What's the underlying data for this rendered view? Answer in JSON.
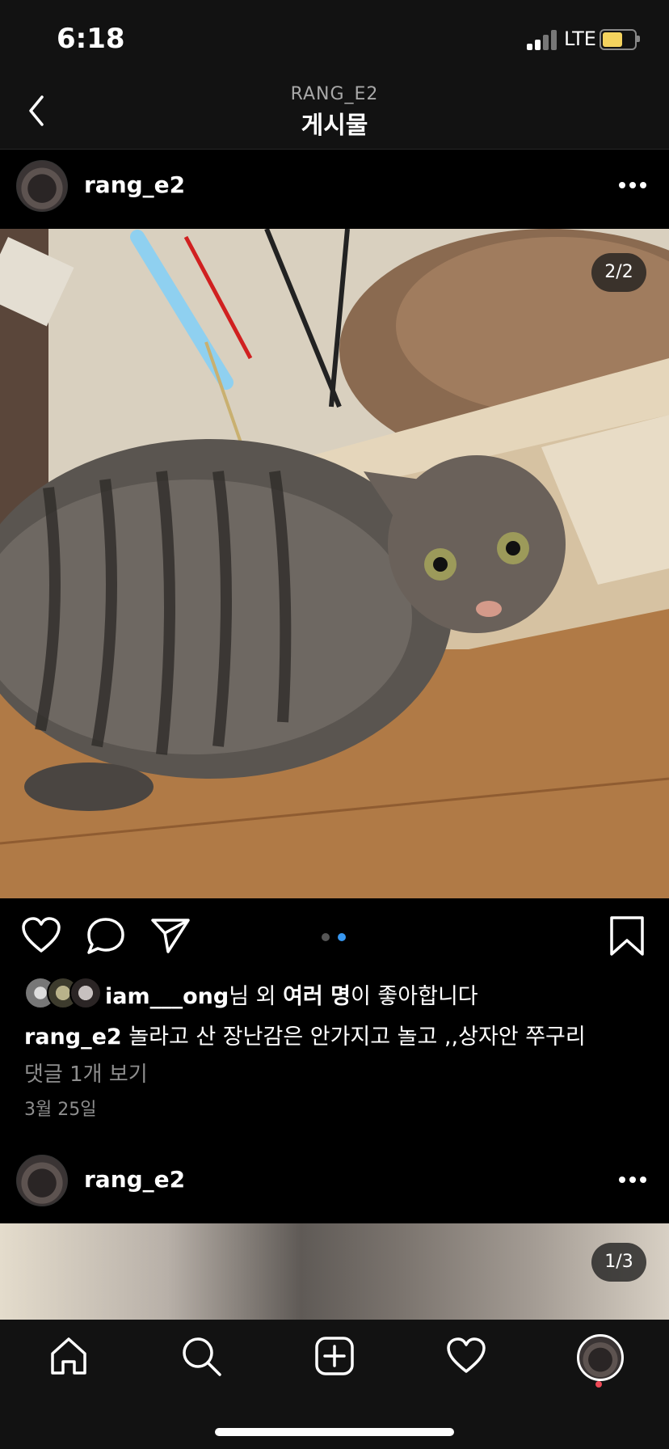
{
  "status_bar": {
    "time": "6:18",
    "carrier": "LTE"
  },
  "nav": {
    "subtitle": "RANG_E2",
    "title": "게시물"
  },
  "post": {
    "username": "rang_e2",
    "image_counter": "2/2",
    "likes": {
      "user": "iam___ong",
      "suffix1": "님 외 ",
      "many": "여러 명",
      "suffix2": "이 좋아합니다"
    },
    "caption": {
      "user": "rang_e2",
      "text": " 놀라고 산 장난감은 안가지고 놀고 ,,상자안 쭈구리"
    },
    "view_comments": "댓글 1개 보기",
    "date": "3월 25일"
  },
  "next_post": {
    "username": "rang_e2",
    "image_counter": "1/3"
  },
  "colors": {
    "background": "#000000",
    "bar": "#121212",
    "active_dot": "#3897f0",
    "muted_text": "#8e8e8e"
  },
  "icons": [
    "back-chevron-icon",
    "more-icon",
    "heart-icon",
    "comment-icon",
    "send-icon",
    "bookmark-icon",
    "home-icon",
    "search-icon",
    "add-post-icon",
    "activity-heart-icon"
  ]
}
